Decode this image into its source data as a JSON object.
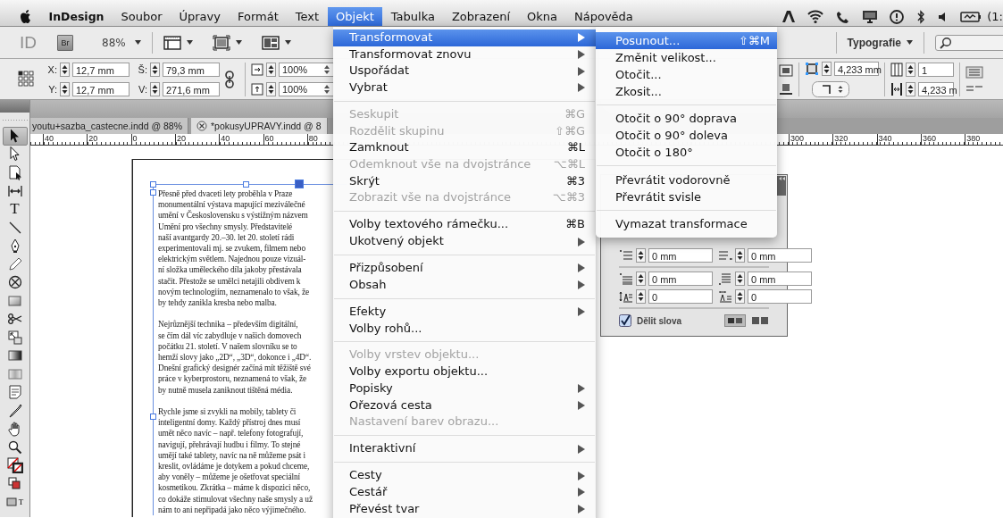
{
  "menubar": {
    "items": [
      {
        "label": "InDesign",
        "kind": "app",
        "selected": false
      },
      {
        "label": "Soubor",
        "kind": "menu",
        "selected": false
      },
      {
        "label": "Úpravy",
        "kind": "menu",
        "selected": false
      },
      {
        "label": "Formát",
        "kind": "menu",
        "selected": false
      },
      {
        "label": "Text",
        "kind": "menu",
        "selected": false
      },
      {
        "label": "Objekt",
        "kind": "menu",
        "selected": true
      },
      {
        "label": "Tabulka",
        "kind": "menu",
        "selected": false
      },
      {
        "label": "Zobrazení",
        "kind": "menu",
        "selected": false
      },
      {
        "label": "Okna",
        "kind": "menu",
        "selected": false
      },
      {
        "label": "Nápověda",
        "kind": "menu",
        "selected": false
      }
    ],
    "status_text": "(1:"
  },
  "app_bar": {
    "logo": "ID",
    "bridge_button": "Br",
    "zoom": "88%",
    "workspace": "Typografie"
  },
  "control_panel": {
    "fields": [
      {
        "label": "X:",
        "value": "12,7 mm"
      },
      {
        "label": "Y:",
        "value": "12,7 mm"
      },
      {
        "label": "Š:",
        "value": "79,3 mm"
      },
      {
        "label": "V:",
        "value": "271,6 mm"
      }
    ],
    "scale": [
      "100%",
      "100%"
    ],
    "stroke_weight": "4,233 mm",
    "columns": "1",
    "gutter": "4,233 m"
  },
  "toolbox": {
    "tools": [
      {
        "kind": "selection",
        "selected": true
      },
      {
        "kind": "direct-selection",
        "selected": false
      },
      {
        "kind": "page",
        "selected": false
      },
      {
        "kind": "gap",
        "selected": false
      },
      {
        "kind": "type",
        "glyph": "T",
        "selected": false
      },
      {
        "kind": "line",
        "selected": false
      },
      {
        "kind": "pen",
        "selected": false
      },
      {
        "kind": "pencil",
        "selected": false
      },
      {
        "kind": "frame",
        "selected": false
      },
      {
        "kind": "rectangle",
        "selected": false
      },
      {
        "kind": "scissors",
        "selected": false
      },
      {
        "kind": "free-transform",
        "selected": false
      },
      {
        "kind": "gradient",
        "selected": false
      },
      {
        "kind": "feather",
        "selected": false
      },
      {
        "kind": "note",
        "selected": false
      },
      {
        "kind": "eyedropper",
        "selected": false
      },
      {
        "kind": "hand",
        "selected": false
      },
      {
        "kind": "zoom",
        "selected": false
      },
      {
        "kind": "fill-stroke",
        "selected": false
      },
      {
        "kind": "default-colors",
        "selected": false
      },
      {
        "kind": "formatting",
        "glyph": "T",
        "selected": false
      }
    ]
  },
  "document_tabs": [
    {
      "title": "youtu+sazba_castecne.indd @ 88%",
      "selected": false
    },
    {
      "title": "*pokusyUPRAVY.indd @ 8",
      "selected": true
    }
  ],
  "ruler": {
    "left_labels": [
      "40",
      "20",
      "0",
      "20",
      "40",
      "60",
      "80"
    ],
    "right_labels": [
      "300",
      "320",
      "340",
      "360",
      "380"
    ]
  },
  "story": {
    "paragraphs": [
      "Přesně před dvaceti lety proběhla v Praze\nmonumentální výstava mapující meziválečné\numění v Československu s výstižným názvem\nUmění pro všechny smysly. Představitelé\nnaší avantgardy 20.–30. let 20. století rádi\nexperimentovali mj. se zvukem, filmem nebo\nelektrickým světlem. Najednou pouze vizuál-\nní složka uměleckého díla jakoby přestávala\nstačit. Přestože se umělci netajili obdivem k\nnovým technologiím, neznamenalo to však, že\nby tehdy zanikla kresba nebo malba.",
      "Nejrůznější technika – především digitální,\nse čím dál víc zabydluje v našich domovech\npočátku 21. století. V našem slovníku se to\nhemží slovy jako „2D“, „3D“, dokonce i „4D“.\nDnešní grafický designér začíná mít těžiště své\npráce v kyberprostoru, neznamená to však, že\nby nutně musela zaniknout tištěná média.",
      "Rychle jsme si zvykli na mobily, tablety či\ninteligentní domy. Každý přístroj dnes musí\numět něco navíc – např. telefony fotografují,\nnavigují, přehrávají hudbu i filmy. To stejné\numějí také tablety, navíc na ně můžeme psát i\nkreslit, ovládáme je dotykem a pokud chceme,\naby voněly – můžeme je ošetřovat speciální\nkosmetikou. Zkrátka – máme k dispozici něco,\nco dokáže stimulovat všechny naše smysly a už\nnám to ani nepřipadá jako něco výjimečného."
    ]
  },
  "object_menu": {
    "items": [
      {
        "kind": "item",
        "label": "Transformovat",
        "submenu": true,
        "disabled": false,
        "selected": true
      },
      {
        "kind": "item",
        "label": "Transformovat znovu",
        "submenu": true,
        "disabled": false,
        "selected": false
      },
      {
        "kind": "item",
        "label": "Uspořádat",
        "submenu": true,
        "disabled": false,
        "selected": false
      },
      {
        "kind": "item",
        "label": "Vybrat",
        "submenu": true,
        "disabled": false,
        "selected": false
      },
      {
        "kind": "separator"
      },
      {
        "kind": "item",
        "label": "Seskupit",
        "shortcut": "⌘G",
        "submenu": false,
        "disabled": true,
        "selected": false
      },
      {
        "kind": "item",
        "label": "Rozdělit skupinu",
        "shortcut": "⇧⌘G",
        "submenu": false,
        "disabled": true,
        "selected": false
      },
      {
        "kind": "item",
        "label": "Zamknout",
        "shortcut": "⌘L",
        "submenu": false,
        "disabled": false,
        "selected": false
      },
      {
        "kind": "item",
        "label": "Odemknout vše na dvojstránce",
        "shortcut": "⌥⌘L",
        "submenu": false,
        "disabled": true,
        "selected": false
      },
      {
        "kind": "item",
        "label": "Skrýt",
        "shortcut": "⌘3",
        "submenu": false,
        "disabled": false,
        "selected": false
      },
      {
        "kind": "item",
        "label": "Zobrazit vše na dvojstránce",
        "shortcut": "⌥⌘3",
        "submenu": false,
        "disabled": true,
        "selected": false
      },
      {
        "kind": "separator"
      },
      {
        "kind": "item",
        "label": "Volby textového rámečku...",
        "shortcut": "⌘B",
        "submenu": false,
        "disabled": false,
        "selected": false
      },
      {
        "kind": "item",
        "label": "Ukotvený objekt",
        "submenu": true,
        "disabled": false,
        "selected": false
      },
      {
        "kind": "separator"
      },
      {
        "kind": "item",
        "label": "Přizpůsobení",
        "submenu": true,
        "disabled": false,
        "selected": false
      },
      {
        "kind": "item",
        "label": "Obsah",
        "submenu": true,
        "disabled": false,
        "selected": false
      },
      {
        "kind": "separator"
      },
      {
        "kind": "item",
        "label": "Efekty",
        "submenu": true,
        "disabled": false,
        "selected": false
      },
      {
        "kind": "item",
        "label": "Volby rohů...",
        "submenu": false,
        "disabled": false,
        "selected": false
      },
      {
        "kind": "separator"
      },
      {
        "kind": "item",
        "label": "Volby vrstev objektu...",
        "submenu": false,
        "disabled": true,
        "selected": false
      },
      {
        "kind": "item",
        "label": "Volby exportu objektu...",
        "submenu": false,
        "disabled": false,
        "selected": false
      },
      {
        "kind": "item",
        "label": "Popisky",
        "submenu": true,
        "disabled": false,
        "selected": false
      },
      {
        "kind": "item",
        "label": "Ořezová cesta",
        "submenu": true,
        "disabled": false,
        "selected": false
      },
      {
        "kind": "item",
        "label": "Nastavení barev obrazu...",
        "submenu": false,
        "disabled": true,
        "selected": false
      },
      {
        "kind": "separator"
      },
      {
        "kind": "item",
        "label": "Interaktivní",
        "submenu": true,
        "disabled": false,
        "selected": false
      },
      {
        "kind": "separator"
      },
      {
        "kind": "item",
        "label": "Cesty",
        "submenu": true,
        "disabled": false,
        "selected": false
      },
      {
        "kind": "item",
        "label": "Cestář",
        "submenu": true,
        "disabled": false,
        "selected": false
      },
      {
        "kind": "item",
        "label": "Převést tvar",
        "submenu": true,
        "disabled": false,
        "selected": false
      }
    ]
  },
  "transform_submenu": {
    "items": [
      {
        "kind": "item",
        "label": "Posunout...",
        "shortcut": "⇧⌘M",
        "submenu": false,
        "disabled": false,
        "selected": true
      },
      {
        "kind": "item",
        "label": "Změnit velikost...",
        "submenu": false,
        "disabled": false,
        "selected": false
      },
      {
        "kind": "item",
        "label": "Otočit...",
        "submenu": false,
        "disabled": false,
        "selected": false
      },
      {
        "kind": "item",
        "label": "Zkosit...",
        "submenu": false,
        "disabled": false,
        "selected": false
      },
      {
        "kind": "separator"
      },
      {
        "kind": "item",
        "label": "Otočit o 90° doprava",
        "submenu": false,
        "disabled": false,
        "selected": false
      },
      {
        "kind": "item",
        "label": "Otočit o 90° doleva",
        "submenu": false,
        "disabled": false,
        "selected": false
      },
      {
        "kind": "item",
        "label": "Otočit o 180°",
        "submenu": false,
        "disabled": false,
        "selected": false
      },
      {
        "kind": "separator"
      },
      {
        "kind": "item",
        "label": "Převrátit vodorovně",
        "submenu": false,
        "disabled": false,
        "selected": false
      },
      {
        "kind": "item",
        "label": "Převrátit svisle",
        "submenu": false,
        "disabled": false,
        "selected": false
      },
      {
        "kind": "separator"
      },
      {
        "kind": "item",
        "label": "Vymazat transformace",
        "submenu": false,
        "disabled": false,
        "selected": false
      }
    ]
  },
  "paragraph_panel": {
    "field_groups": [
      [
        {
          "kind": "first-indent",
          "value": "0 mm"
        },
        {
          "kind": "last-indent",
          "value": "0 mm"
        }
      ],
      [
        {
          "kind": "space-before",
          "value": "0 mm"
        },
        {
          "kind": "space-after",
          "value": "0 mm"
        },
        {
          "kind": "drop-lines",
          "value": "0"
        },
        {
          "kind": "drop-chars",
          "value": "0"
        }
      ]
    ],
    "hyphenate": {
      "label": "Dělit slova",
      "checked": true
    }
  }
}
